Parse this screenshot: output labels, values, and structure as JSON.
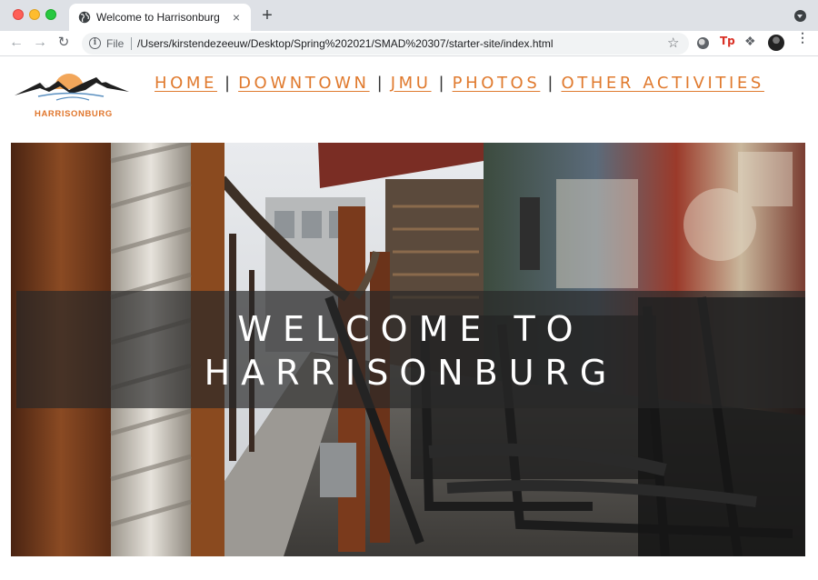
{
  "browser": {
    "tab_title": "Welcome to Harrisonburg",
    "tab_close": "×",
    "new_tab": "+",
    "file_label": "File",
    "url": "/Users/kirstendezeeuw/Desktop/Spring%202021/SMAD%20307/starter-site/index.html",
    "extension_tp": "Tp"
  },
  "site": {
    "logo_text": "HARRISONBURG",
    "nav": [
      {
        "label": "HOME"
      },
      {
        "label": "DOWNTOWN"
      },
      {
        "label": "JMU"
      },
      {
        "label": "PHOTOS"
      },
      {
        "label": "OTHER ACTIVITIES"
      }
    ],
    "separator": "|",
    "hero_line1": "WELCOME TO",
    "hero_line2": "HARRISONBURG"
  },
  "colors": {
    "accent": "#e07a2e",
    "banner_overlay": "rgba(40,40,40,0.68)",
    "chrome_bg": "#dee1e6"
  }
}
